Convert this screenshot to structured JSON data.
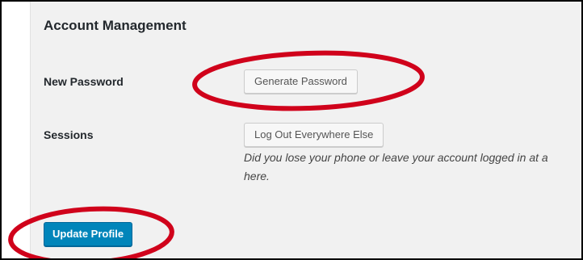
{
  "account_management": {
    "section_title": "Account Management",
    "new_password": {
      "label": "New Password",
      "button_label": "Generate Password"
    },
    "sessions": {
      "label": "Sessions",
      "button_label": "Log Out Everywhere Else",
      "description_line1": "Did you lose your phone or leave your account logged in at a",
      "description_line2": "here."
    }
  },
  "footer": {
    "update_button_label": "Update Profile"
  },
  "colors": {
    "primary_button": "#0085ba",
    "annotation_circle": "#d0021b",
    "background": "#f1f1f1"
  }
}
